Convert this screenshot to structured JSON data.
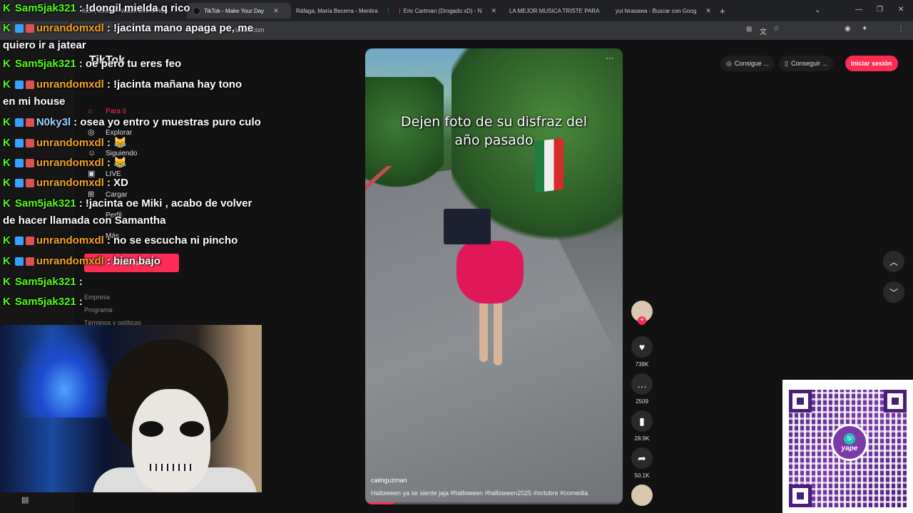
{
  "browser": {
    "tabs": [
      {
        "label": "Kick | Stream - Watch Live on Kick",
        "icon": "kick-icon"
      },
      {
        "label": "TikTok - Make Your Day",
        "icon": "tiktok-icon",
        "active": true
      },
      {
        "label": "Ráfaga, María Becerra - Mentira",
        "icon": "youtube-icon"
      },
      {
        "label": "Eric Cartman (Drogado xD) - N",
        "icon": "youtube-icon"
      },
      {
        "label": "LA MEJOR MUSICA TRISTE PARA",
        "icon": "youtube-icon"
      },
      {
        "label": "yui hirasawa - Buscar con Goog",
        "icon": "google-icon"
      }
    ],
    "url": "tiktok.com"
  },
  "tiktok": {
    "logo": "TikTok",
    "nav": [
      "Para ti",
      "Explorar",
      "Siguiendo",
      "LIVE",
      "Cargar",
      "Perfil",
      "Más"
    ],
    "login_button": "Iniciar sesión",
    "footer": [
      "Empresa",
      "Programa",
      "Términos y políticas"
    ],
    "top_buttons": {
      "coins": "Consigue ...",
      "app": "Conseguir ...",
      "login": "Iniciar sesión"
    },
    "video": {
      "caption_line1": "Dejen foto de su disfraz del",
      "caption_line2": "año pasado",
      "author": "caiinguzman",
      "description": "Halloween ya se siente jaja #halloween #halloween2025 #octubre #comedia",
      "progress": 0.11
    },
    "actions": {
      "likes": "739K",
      "comments": "2509",
      "saves": "28.9K",
      "shares": "50.1K"
    },
    "colors": {
      "accent": "#fe2c55"
    }
  },
  "chat": {
    "messages": [
      {
        "user": "Sam5jak321",
        "color": "#53fc18",
        "text": ": !dongil mielda q rico",
        "cont": ""
      },
      {
        "user": "unrandomxdl",
        "color": "#f5a623",
        "text": ": !jacinta mano apaga pe, me",
        "cont": "quiero ir a jatear"
      },
      {
        "user": "Sam5jak321",
        "color": "#53fc18",
        "text": ": oe pero tu eres feo",
        "cont": ""
      },
      {
        "user": "unrandomxdl",
        "color": "#f5a623",
        "text": ": !jacinta mañana hay tono",
        "cont": "en mi house"
      },
      {
        "user": "N0ky3l",
        "color": "#9ad7ff",
        "text": ": osea yo entro y muestras puro culo",
        "cont": ""
      },
      {
        "user": "unrandomxdl",
        "color": "#f5a623",
        "text": ": 😹",
        "cont": ""
      },
      {
        "user": "unrandomxdl",
        "color": "#f5a623",
        "text": ": 😹",
        "cont": ""
      },
      {
        "user": "unrandomxdl",
        "color": "#f5a623",
        "text": ": XD",
        "cont": ""
      },
      {
        "user": "Sam5jak321",
        "color": "#53fc18",
        "text": ": !jacinta oe Miki , acabo de volver",
        "cont": "de hacer llamada con Samantha"
      },
      {
        "user": "unrandomxdl",
        "color": "#f5a623",
        "text": ": no se escucha ni pincho",
        "cont": ""
      },
      {
        "user": "unrandomxdl",
        "color": "#f5a623",
        "text": ": bien bajo",
        "cont": ""
      },
      {
        "user": "Sam5jak321",
        "color": "#53fc18",
        "text": ":",
        "cont": ""
      },
      {
        "user": "Sam5jak321",
        "color": "#53fc18",
        "text": ":",
        "cont": ""
      }
    ]
  },
  "qr": {
    "brand": "yape",
    "badge": "S/"
  }
}
